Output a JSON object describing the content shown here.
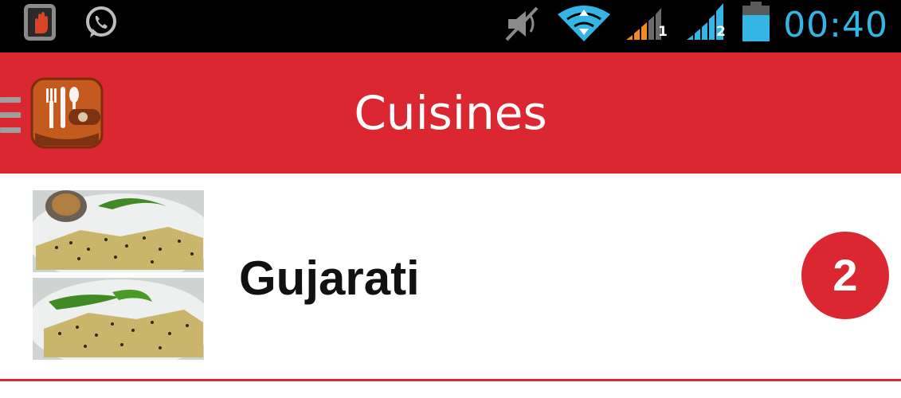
{
  "status_bar": {
    "time": "00:40",
    "sim1_label": "1",
    "sim2_label": "2",
    "icons": [
      "phone-hand-icon",
      "whatsapp-icon",
      "mute-icon",
      "wifi-icon",
      "signal-sim1-icon",
      "signal-sim2-icon",
      "battery-icon"
    ],
    "time_color": "#33b5e5"
  },
  "action_bar": {
    "title": "Cuisines",
    "background_color": "#da2731",
    "app_icon": "cutlery-wallet-icon"
  },
  "list": {
    "items": [
      {
        "label": "Gujarati",
        "count": "2",
        "thumbnails": [
          "dhokla-photo",
          "dhokla-photo"
        ]
      }
    ]
  }
}
